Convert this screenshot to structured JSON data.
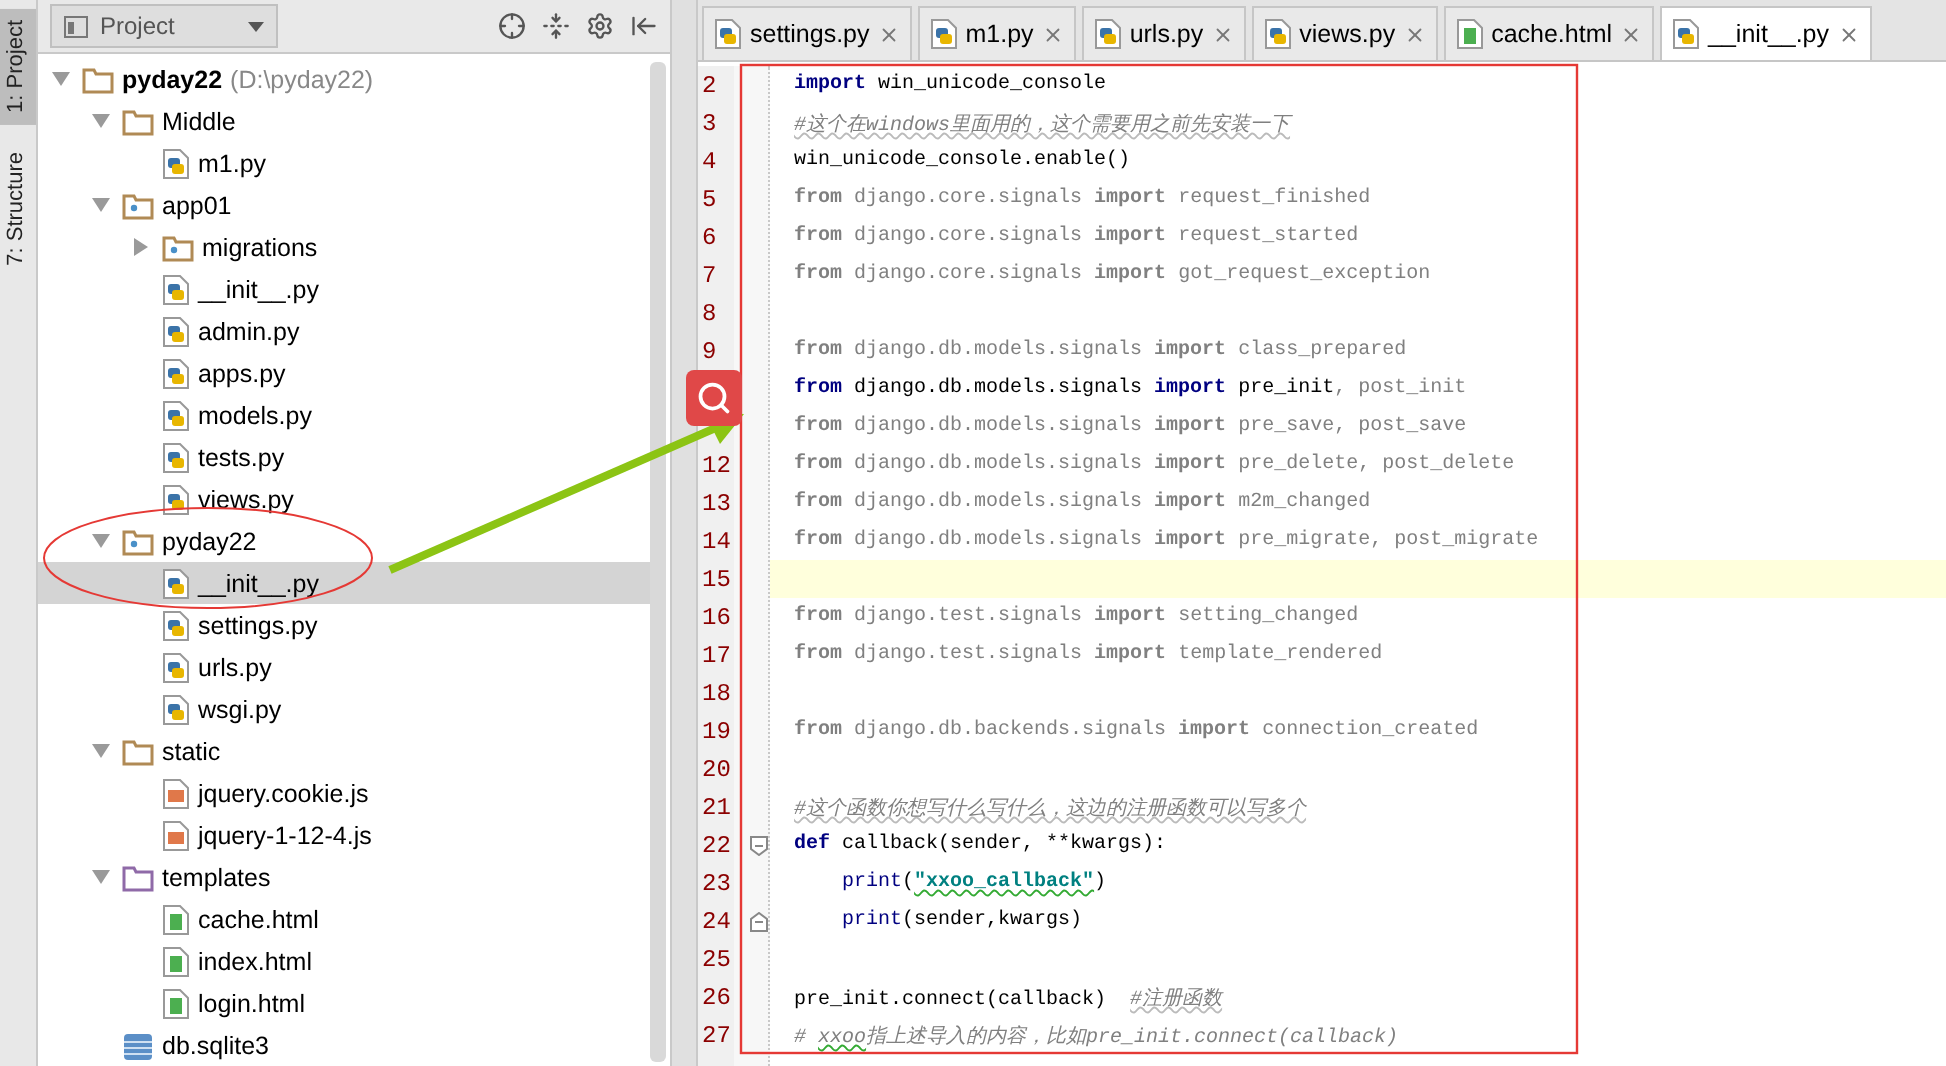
{
  "side_tabs": [
    {
      "label": "1: Project",
      "selected": true
    },
    {
      "label": "7: Structure",
      "selected": false
    }
  ],
  "project_panel": {
    "title": "Project"
  },
  "tree": [
    {
      "name": "pyday22",
      "path": "(D:\\pyday22)",
      "kind": "folder",
      "expanded": true,
      "selected": false,
      "children": [
        {
          "name": "Middle",
          "kind": "folder",
          "expanded": true,
          "selected": false,
          "children": [
            {
              "name": "m1.py",
              "kind": "py",
              "selected": false
            }
          ]
        },
        {
          "name": "app01",
          "kind": "package",
          "expanded": true,
          "selected": false,
          "children": [
            {
              "name": "migrations",
              "kind": "package",
              "expanded": false,
              "selected": false
            },
            {
              "name": "__init__.py",
              "kind": "py",
              "selected": false
            },
            {
              "name": "admin.py",
              "kind": "py",
              "selected": false
            },
            {
              "name": "apps.py",
              "kind": "py",
              "selected": false
            },
            {
              "name": "models.py",
              "kind": "py",
              "selected": false
            },
            {
              "name": "tests.py",
              "kind": "py",
              "selected": false
            },
            {
              "name": "views.py",
              "kind": "py",
              "selected": false
            }
          ]
        },
        {
          "name": "pyday22",
          "kind": "package",
          "expanded": true,
          "selected": false,
          "children": [
            {
              "name": "__init__.py",
              "kind": "py",
              "selected": true
            },
            {
              "name": "settings.py",
              "kind": "py",
              "selected": false
            },
            {
              "name": "urls.py",
              "kind": "py",
              "selected": false
            },
            {
              "name": "wsgi.py",
              "kind": "py",
              "selected": false
            }
          ]
        },
        {
          "name": "static",
          "kind": "folder",
          "expanded": true,
          "selected": false,
          "children": [
            {
              "name": "jquery.cookie.js",
              "kind": "js",
              "selected": false
            },
            {
              "name": "jquery-1-12-4.js",
              "kind": "js",
              "selected": false
            }
          ]
        },
        {
          "name": "templates",
          "kind": "templates",
          "expanded": true,
          "selected": false,
          "children": [
            {
              "name": "cache.html",
              "kind": "html",
              "selected": false
            },
            {
              "name": "index.html",
              "kind": "html",
              "selected": false
            },
            {
              "name": "login.html",
              "kind": "html",
              "selected": false
            }
          ]
        },
        {
          "name": "db.sqlite3",
          "kind": "db",
          "selected": false
        }
      ]
    }
  ],
  "editor_tabs": [
    {
      "label": "settings.py",
      "kind": "py",
      "selected": false
    },
    {
      "label": "m1.py",
      "kind": "py",
      "selected": false
    },
    {
      "label": "urls.py",
      "kind": "py",
      "selected": false
    },
    {
      "label": "views.py",
      "kind": "py",
      "selected": false
    },
    {
      "label": "cache.html",
      "kind": "html",
      "selected": false
    },
    {
      "label": "__init__.py",
      "kind": "py",
      "selected": true
    }
  ],
  "code": [
    {
      "n": "2",
      "current": false,
      "tokens": [
        {
          "t": "import",
          "kind": "kw"
        },
        {
          "t": " win_unicode_console",
          "kind": "plain"
        }
      ]
    },
    {
      "n": "3",
      "current": false,
      "tokens": [
        {
          "t": "#这个在windows里面用的，这个需要用之前先安装一下",
          "kind": "comment"
        }
      ]
    },
    {
      "n": "4",
      "current": false,
      "tokens": [
        {
          "t": "win_unicode_console.enable()",
          "kind": "plain"
        }
      ]
    },
    {
      "n": "5",
      "current": false,
      "tokens": [
        {
          "t": "from",
          "kind": "dimkw"
        },
        {
          "t": " django.core.signals ",
          "kind": "dim"
        },
        {
          "t": "import",
          "kind": "dimkw"
        },
        {
          "t": " request_finished",
          "kind": "dim"
        }
      ]
    },
    {
      "n": "6",
      "current": false,
      "tokens": [
        {
          "t": "from",
          "kind": "dimkw"
        },
        {
          "t": " django.core.signals ",
          "kind": "dim"
        },
        {
          "t": "import",
          "kind": "dimkw"
        },
        {
          "t": " request_started",
          "kind": "dim"
        }
      ]
    },
    {
      "n": "7",
      "current": false,
      "tokens": [
        {
          "t": "from",
          "kind": "dimkw"
        },
        {
          "t": " django.core.signals ",
          "kind": "dim"
        },
        {
          "t": "import",
          "kind": "dimkw"
        },
        {
          "t": " got_request_exception",
          "kind": "dim"
        }
      ]
    },
    {
      "n": "8",
      "current": false
    },
    {
      "n": "9",
      "current": false,
      "tokens": [
        {
          "t": "from",
          "kind": "dimkw"
        },
        {
          "t": " django.db.models.signals ",
          "kind": "dim"
        },
        {
          "t": "import",
          "kind": "dimkw"
        },
        {
          "t": " class_prepared",
          "kind": "dim"
        }
      ]
    },
    {
      "current": false,
      "tokens": [
        {
          "t": "from",
          "kind": "kw"
        },
        {
          "t": " django.db.models.signals ",
          "kind": "plain"
        },
        {
          "t": "import",
          "kind": "kw"
        },
        {
          "t": " pre_init",
          "kind": "plain"
        },
        {
          "t": ", post_init",
          "kind": "dim"
        }
      ]
    },
    {
      "current": false,
      "tokens": [
        {
          "t": "from",
          "kind": "dimkw"
        },
        {
          "t": " django.db.models.signals ",
          "kind": "dim"
        },
        {
          "t": "import",
          "kind": "dimkw"
        },
        {
          "t": " pre_save, post_save",
          "kind": "dim"
        }
      ]
    },
    {
      "n": "12",
      "current": false,
      "tokens": [
        {
          "t": "from",
          "kind": "dimkw"
        },
        {
          "t": " django.db.models.signals ",
          "kind": "dim"
        },
        {
          "t": "import",
          "kind": "dimkw"
        },
        {
          "t": " pre_delete, post_delete",
          "kind": "dim"
        }
      ]
    },
    {
      "n": "13",
      "current": false,
      "tokens": [
        {
          "t": "from",
          "kind": "dimkw"
        },
        {
          "t": " django.db.models.signals ",
          "kind": "dim"
        },
        {
          "t": "import",
          "kind": "dimkw"
        },
        {
          "t": " m2m_changed",
          "kind": "dim"
        }
      ]
    },
    {
      "n": "14",
      "current": false,
      "tokens": [
        {
          "t": "from",
          "kind": "dimkw"
        },
        {
          "t": " django.db.models.signals ",
          "kind": "dim"
        },
        {
          "t": "import",
          "kind": "dimkw"
        },
        {
          "t": " pre_migrate, post_migrate",
          "kind": "dim"
        }
      ]
    },
    {
      "n": "15",
      "current": true
    },
    {
      "n": "16",
      "current": false,
      "tokens": [
        {
          "t": "from",
          "kind": "dimkw"
        },
        {
          "t": " django.test.signals ",
          "kind": "dim"
        },
        {
          "t": "import",
          "kind": "dimkw"
        },
        {
          "t": " setting_changed",
          "kind": "dim"
        }
      ]
    },
    {
      "n": "17",
      "current": false,
      "tokens": [
        {
          "t": "from",
          "kind": "dimkw"
        },
        {
          "t": " django.test.signals ",
          "kind": "dim"
        },
        {
          "t": "import",
          "kind": "dimkw"
        },
        {
          "t": " template_rendered",
          "kind": "dim"
        }
      ]
    },
    {
      "n": "18",
      "current": false
    },
    {
      "n": "19",
      "current": false,
      "tokens": [
        {
          "t": "from",
          "kind": "dimkw"
        },
        {
          "t": " django.db.backends.signals ",
          "kind": "dim"
        },
        {
          "t": "import",
          "kind": "dimkw"
        },
        {
          "t": " connection_created",
          "kind": "dim"
        }
      ]
    },
    {
      "n": "20",
      "current": false
    },
    {
      "n": "21",
      "current": false,
      "tokens": [
        {
          "t": "#这个函数你想写什么写什么，这边的注册函数可以写多个",
          "kind": "comment"
        }
      ]
    },
    {
      "n": "22",
      "current": false,
      "kind": "fold-start",
      "tokens": [
        {
          "t": "def",
          "kind": "kw"
        },
        {
          "t": " callback(sender, **kwargs):",
          "kind": "plain"
        }
      ]
    },
    {
      "n": "23",
      "current": false,
      "indent": true,
      "tokens": [
        {
          "t": "print",
          "kind": "builtin"
        },
        {
          "t": "(",
          "kind": "plain"
        },
        {
          "t": "\"xxoo_callback\"",
          "kind": "string"
        },
        {
          "t": ")",
          "kind": "plain"
        }
      ]
    },
    {
      "n": "24",
      "current": false,
      "indent": true,
      "kind": "fold-end",
      "tokens": [
        {
          "t": "print",
          "kind": "builtin"
        },
        {
          "t": "(sender,kwargs)",
          "kind": "plain"
        }
      ]
    },
    {
      "n": "25",
      "current": false
    },
    {
      "n": "26",
      "current": false,
      "tokens": [
        {
          "t": "pre_init.connect(callback)  ",
          "kind": "plain"
        },
        {
          "t": "#注册函数",
          "kind": "comment"
        }
      ]
    },
    {
      "n": "27",
      "current": false,
      "tokens": [
        {
          "t": "# ",
          "kind": "note"
        },
        {
          "t": "xxoo",
          "kind": "typo"
        },
        {
          "t": "指上述导入的内容，比如pre_init.connect(callback)",
          "kind": "note"
        }
      ]
    }
  ]
}
